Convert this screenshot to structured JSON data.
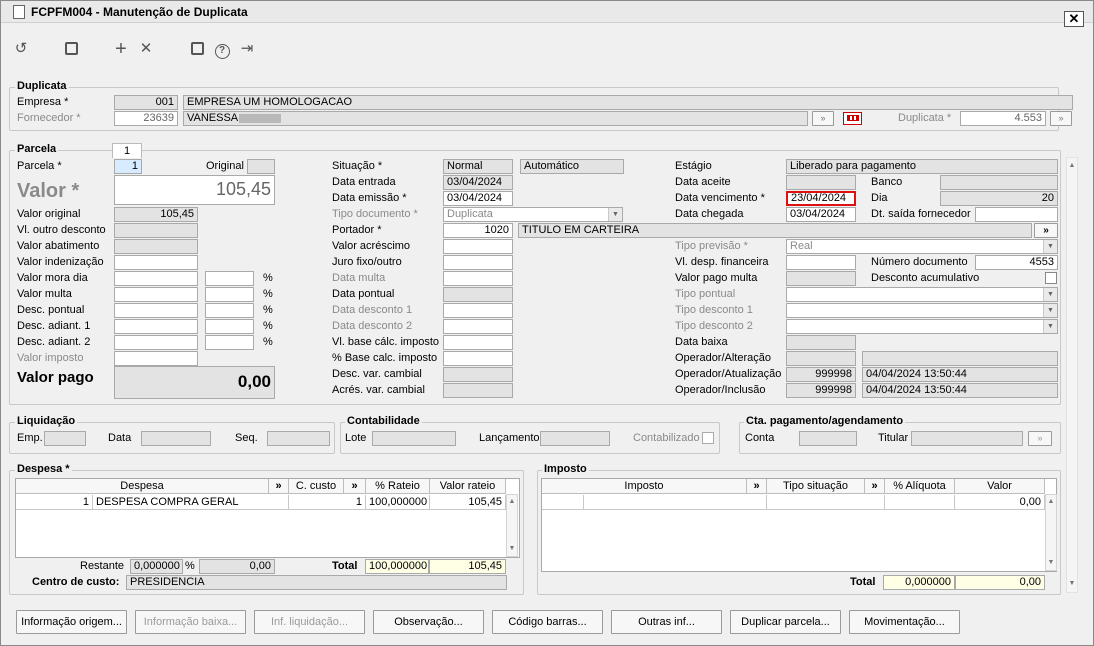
{
  "window": {
    "title": "FCPFM004 - Manutenção de Duplicata",
    "close": "✕"
  },
  "toolbar": {
    "undo": "↺",
    "save": "💾",
    "add": "+",
    "remove": "✕",
    "calendar": "📅",
    "help": "?",
    "exit": "⇥"
  },
  "duplicata": {
    "title": "Duplicata",
    "empresa_label": "Empresa *",
    "empresa_code": "001",
    "empresa_name": "EMPRESA UM HOMOLOGACAO",
    "fornecedor_label": "Fornecedor *",
    "fornecedor_code": "23639",
    "fornecedor_name": "VANESSA",
    "dup_label": "Duplicata *",
    "dup_value": "4.553",
    "more": "»"
  },
  "parcela": {
    "title": "Parcela",
    "tab": "1",
    "parcela_label": "Parcela *",
    "parcela_value": "1",
    "original_label": "Original",
    "valor_label": "Valor *",
    "valor_value": "105,45",
    "left_labels": [
      "Valor original",
      "Vl. outro desconto",
      "Valor abatimento",
      "Valor indenização",
      "Valor mora dia",
      "Valor multa",
      "Desc. pontual",
      "Desc. adiant. 1",
      "Desc. adiant. 2",
      "Valor imposto"
    ],
    "valor_original": "105,45",
    "pct": "%",
    "valor_pago_label": "Valor pago",
    "valor_pago_value": "0,00",
    "mid_labels": [
      "Situação *",
      "Data entrada",
      "Data emissão *",
      "Tipo documento *",
      "Portador *",
      "Valor acréscimo",
      "Juro fixo/outro",
      "Data multa",
      "Data pontual",
      "Data desconto 1",
      "Data desconto 2",
      "Vl. base cálc. imposto",
      "% Base calc. imposto",
      "Desc. var. cambial",
      "Acrés. var. cambial"
    ],
    "situacao": "Normal",
    "situacao2": "Automático",
    "data_entrada": "03/04/2024",
    "data_emissao": "03/04/2024",
    "tipo_documento": "Duplicata",
    "portador_code": "1020",
    "portador_name": "TITULO EM CARTEIRA",
    "right_labels": [
      "Estágio",
      "Data aceite",
      "Data vencimento *",
      "Data chegada",
      "",
      "Tipo previsão *",
      "Vl. desp. financeira",
      "Valor pago multa",
      "Tipo pontual",
      "Tipo desconto 1",
      "Tipo desconto 2",
      "Data baixa",
      "Operador/Alteração",
      "Operador/Atualização",
      "Operador/Inclusão"
    ],
    "estagio": "Liberado para pagamento",
    "data_vencimento": "23/04/2024",
    "data_chegada": "03/04/2024",
    "tipo_previsao": "Real",
    "banco_label": "Banco",
    "dia_label": "Dia",
    "dia_value": "20",
    "dt_saida_label": "Dt. saída fornecedor",
    "num_doc_label": "Número documento",
    "num_doc_value": "4553",
    "desc_acum_label": "Desconto acumulativo",
    "op_atual_code": "999998",
    "op_atual_date": "04/04/2024 13:50:44",
    "op_incl_code": "999998",
    "op_incl_date": "04/04/2024 13:50:44"
  },
  "liquidacao": {
    "title": "Liquidação",
    "emp": "Emp.",
    "data": "Data",
    "seq": "Seq."
  },
  "contabilidade": {
    "title": "Contabilidade",
    "lote": "Lote",
    "lancamento": "Lançamento",
    "contabilizado": "Contabilizado"
  },
  "cta": {
    "title": "Cta. pagamento/agendamento",
    "conta": "Conta",
    "titular": "Titular"
  },
  "despesa": {
    "title": "Despesa *",
    "headers": [
      "Despesa",
      "»",
      "C. custo",
      "»",
      "% Rateio",
      "Valor rateio"
    ],
    "row": {
      "code": "1",
      "name": "DESPESA COMPRA GERAL",
      "ccusto": "1",
      "rateio": "100,000000",
      "valor": "105,45"
    },
    "restante_label": "Restante",
    "restante_pct": "0,000000",
    "restante_valor": "0,00",
    "total_label": "Total",
    "total_pct": "100,000000",
    "total_valor": "105,45",
    "cc_label": "Centro de custo:",
    "cc_value": "PRESIDENCIA"
  },
  "imposto": {
    "title": "Imposto",
    "headers": [
      "Imposto",
      "»",
      "Tipo situação",
      "»",
      "% Alíquota",
      "Valor"
    ],
    "row_valor": "0,00",
    "total_label": "Total",
    "total_pct": "0,000000",
    "total_valor": "0,00"
  },
  "buttons": [
    "Informação origem...",
    "Informação baixa...",
    "Inf. liquidação...",
    "Observação...",
    "Código barras...",
    "Outras inf...",
    "Duplicar parcela...",
    "Movimentação..."
  ]
}
